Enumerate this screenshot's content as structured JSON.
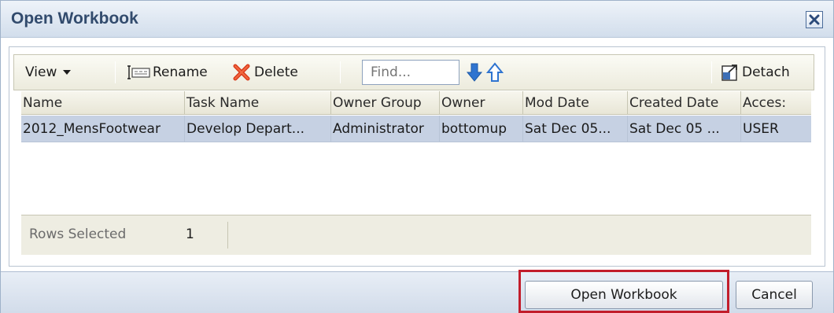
{
  "dialog": {
    "title": "Open Workbook"
  },
  "toolbar": {
    "view_label": "View",
    "rename_label": "Rename",
    "delete_label": "Delete",
    "find_placeholder": "Find...",
    "detach_label": "Detach"
  },
  "table": {
    "columns": [
      "Name",
      "Task Name",
      "Owner Group",
      "Owner",
      "Mod Date",
      "Created Date",
      "Access"
    ],
    "columns_display": [
      "Name",
      "Task Name",
      "Owner Group",
      "Owner",
      "Mod Date",
      "Created Date",
      "Acces:"
    ],
    "rows": [
      [
        "2012_MensFootwear",
        "Develop Depart...",
        "Administrator",
        "bottomup",
        "Sat Dec 05...",
        "Sat Dec 05 ...",
        "USER"
      ]
    ]
  },
  "status": {
    "rows_selected_label": "Rows Selected",
    "rows_selected_value": "1"
  },
  "footer": {
    "open_label": "Open Workbook",
    "cancel_label": "Cancel"
  },
  "colors": {
    "title_text": "#324b6d",
    "selected_row": "#c6d1e3",
    "highlight_border": "#c21d2b",
    "arrow_blue": "#2f74d0"
  },
  "icons": [
    "close-icon",
    "dropdown-arrow-icon",
    "rename-icon",
    "delete-icon",
    "arrow-down-icon",
    "arrow-up-icon",
    "detach-icon"
  ]
}
